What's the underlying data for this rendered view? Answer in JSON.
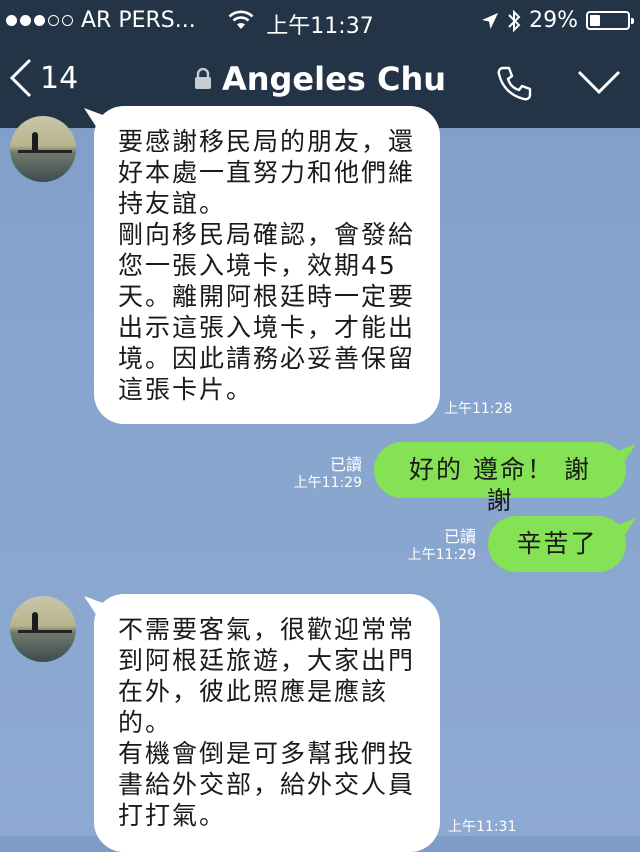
{
  "status_bar": {
    "carrier": "AR PERS...",
    "time": "上午11:37",
    "battery_percent": "29%",
    "battery_level": 0.29
  },
  "nav": {
    "back_count": "14",
    "title": "Angeles Chu",
    "page_dots": 3,
    "active_dot": 0
  },
  "messages": [
    {
      "direction": "in",
      "lines": [
        "要感謝移民局的朋友，還",
        "好本處一直努力和他們維",
        "持友誼。",
        "剛向移民局確認，會發給",
        "您一張入境卡，效期45",
        "天。離開阿根廷時一定要",
        "出示這張入境卡，才能出",
        "境。因此請務必妥善保留",
        "這張卡片。"
      ],
      "time": "上午11:28"
    },
    {
      "direction": "out",
      "text": "好的 遵命！ 謝謝",
      "read": "已讀",
      "time": "上午11:29"
    },
    {
      "direction": "out",
      "text": "辛苦了",
      "read": "已讀",
      "time": "上午11:29"
    },
    {
      "direction": "in",
      "lines": [
        "不需要客氣，很歡迎常常",
        "到阿根廷旅遊，大家出門",
        "在外，彼此照應是應該",
        "的。",
        "有機會倒是可多幫我們投",
        "書給外交部，給外交人員",
        "打打氣。"
      ],
      "time": "上午11:31"
    }
  ],
  "colors": {
    "header_bg": "#243447",
    "outgoing_bubble": "#84e254",
    "incoming_bubble": "#ffffff"
  }
}
